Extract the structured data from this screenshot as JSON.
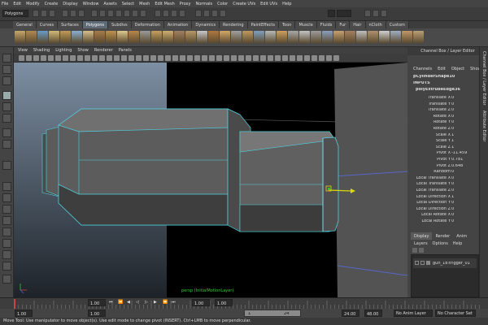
{
  "menubar": [
    "File",
    "Edit",
    "Modify",
    "Create",
    "Display",
    "Window",
    "Assets",
    "Select",
    "Mesh",
    "Edit Mesh",
    "Proxy",
    "Normals",
    "Color",
    "Create UVs",
    "Edit UVs",
    "Help"
  ],
  "status": {
    "mode": "Polygons"
  },
  "shelf": {
    "tabs": [
      "General",
      "Curves",
      "Surfaces",
      "Polygons",
      "Subdivs",
      "Deformation",
      "Animation",
      "Dynamics",
      "Rendering",
      "PaintEffects",
      "Toon",
      "Muscle",
      "Fluids",
      "Fur",
      "Hair",
      "nCloth",
      "Custom"
    ],
    "active": "Polygons"
  },
  "viewport": {
    "menu": [
      "View",
      "Shading",
      "Lighting",
      "Show",
      "Renderer",
      "Panels"
    ],
    "camera": "persp (InitialMotionLayer)"
  },
  "channelbox": {
    "title": "Channel Box / Layer Editor",
    "menu": [
      "Channels",
      "Edit",
      "Object",
      "Show"
    ],
    "shape": "pCylinderShape10",
    "inputs": "INPUTS",
    "node": "polyExtrudeEdge36",
    "attrs": [
      {
        "label": "Translate X",
        "value": "0"
      },
      {
        "label": "Translate Y",
        "value": "0"
      },
      {
        "label": "Translate Z",
        "value": "0"
      },
      {
        "label": "Rotate X",
        "value": "0"
      },
      {
        "label": "Rotate Y",
        "value": "0"
      },
      {
        "label": "Rotate Z",
        "value": "0"
      },
      {
        "label": "Scale X",
        "value": "1"
      },
      {
        "label": "Scale Y",
        "value": "1"
      },
      {
        "label": "Scale Z",
        "value": "1"
      },
      {
        "label": "Pivot X",
        "value": "-11.459"
      },
      {
        "label": "Pivot Y",
        "value": "0.781"
      },
      {
        "label": "Pivot Z",
        "value": "0.648"
      },
      {
        "label": "Random",
        "value": "0"
      },
      {
        "label": "Local Translate X",
        "value": "0"
      },
      {
        "label": "Local Translate Y",
        "value": "0"
      },
      {
        "label": "Local Translate Z",
        "value": "0"
      },
      {
        "label": "Local Direction X",
        "value": "1"
      },
      {
        "label": "Local Direction Y",
        "value": "0"
      },
      {
        "label": "Local Direction Z",
        "value": "0"
      },
      {
        "label": "Local Rotate X",
        "value": "0"
      },
      {
        "label": "Local Rotate Y",
        "value": "0"
      }
    ],
    "side_tabs": [
      "Channel Box / Layer Editor",
      "Attribute Editor"
    ]
  },
  "layers": {
    "tabs": [
      "Display",
      "Render",
      "Anim"
    ],
    "active": "Display",
    "menu": [
      "Layers",
      "Options",
      "Help"
    ],
    "items": [
      {
        "name": "gun_18:trigger_01"
      }
    ]
  },
  "timeline": {
    "start": "1.00",
    "range_start": "1.00",
    "current_frame": "1",
    "range_end_marker": "24",
    "range_end": "24.00",
    "end": "48.00",
    "anim_layer": "No Anim Layer",
    "char_set": "No Character Set",
    "left_field": "1.00",
    "left_field2": "1.00",
    "left_field3": "1.00"
  },
  "help": "Move Tool: Use manipulator to move object(s). Use edit mode to change pivot (INSERT). Ctrl+LMB to move perpendicular."
}
